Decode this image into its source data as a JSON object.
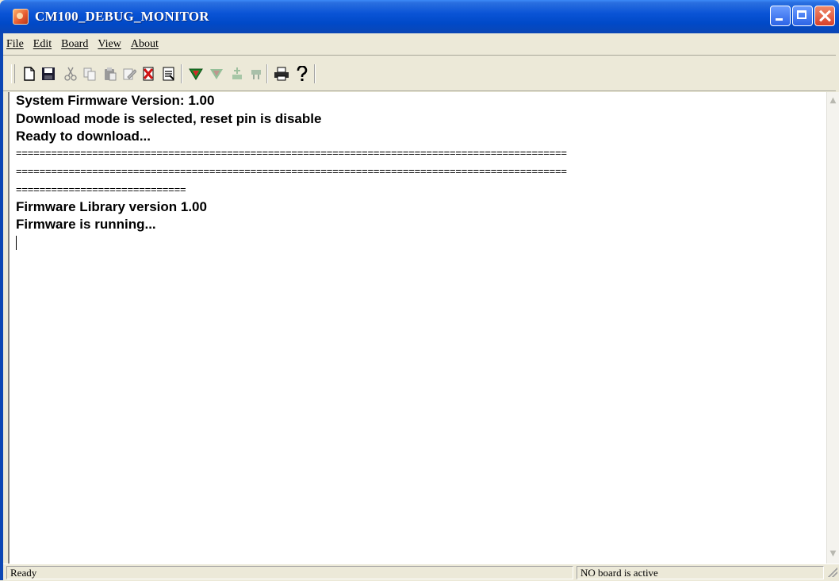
{
  "window": {
    "title": "CM100_DEBUG_MONITOR"
  },
  "menu": {
    "items": [
      {
        "label": "File"
      },
      {
        "label": "Edit"
      },
      {
        "label": "Board"
      },
      {
        "label": "View"
      },
      {
        "label": "About"
      }
    ]
  },
  "toolbar": {
    "icons": [
      "new-file-icon",
      "save-icon",
      "cut-icon",
      "copy-icon",
      "paste-icon",
      "edit-icon",
      "delete-icon",
      "compare-icon",
      "download-icon",
      "upload-icon",
      "connect-icon",
      "disconnect-icon",
      "print-icon",
      "help-icon"
    ]
  },
  "console": {
    "lines": [
      "System Firmware Version: 1.00",
      "Download mode is selected, reset pin is disable",
      "Ready to download...",
      "==============================================================================================",
      "==============================================================================================",
      "=============================",
      "Firmware Library version 1.00",
      "Firmware is running..."
    ]
  },
  "status": {
    "left": "Ready",
    "right": "NO board is active"
  },
  "colors": {
    "titlebar": "#0a54d6",
    "chrome": "#ece9d8",
    "console_bg": "#ffffff"
  }
}
